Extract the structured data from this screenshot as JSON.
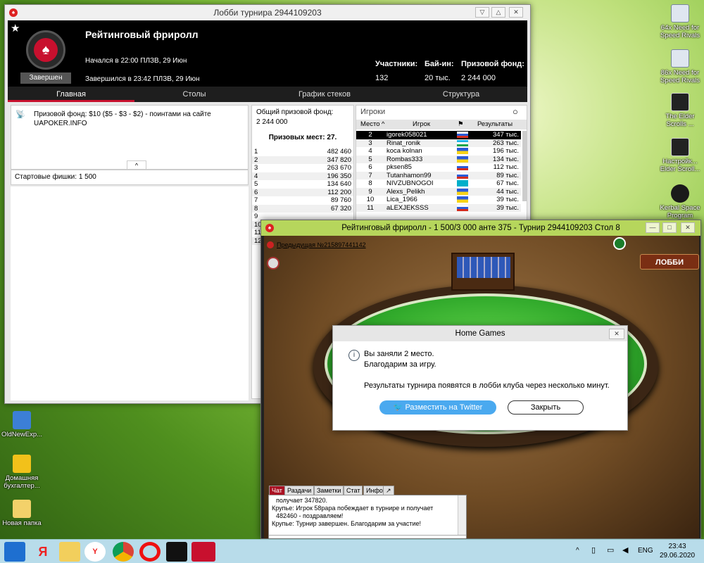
{
  "desktop_icons": [
    {
      "label": "64x Need for Speed Rivals"
    },
    {
      "label": "86x Need for Speed Rivals"
    },
    {
      "label": "The Elder Scrolls ..."
    },
    {
      "label": "Настройк... Elder Scroll..."
    },
    {
      "label": "Kerbal Space Program"
    },
    {
      "label": "OldNewExp..."
    },
    {
      "label": "Домашняя бухгалтер..."
    },
    {
      "label": "Новая папка"
    }
  ],
  "lobby": {
    "title": "Лобби турнира 2944109203",
    "tournament_name": "Рейтинговый фриролл",
    "status": "Завершен",
    "started": "Начался в 22:00 ПЛЗВ, 29 Июн",
    "ended": "Завершился в 23:42 ПЛЗВ, 29 Июн",
    "stats_labels": [
      "Участники:",
      "Бай-ин:",
      "Призовой фонд:"
    ],
    "stats_values": [
      "132",
      "20 тыс.",
      "2 244 000"
    ],
    "tabs": [
      "Главная",
      "Столы",
      "График стеков",
      "Структура"
    ],
    "info_text": "Призовой фонд: $10 ($5 - $3 - $2) - поинтами на сайте UAPOKER.INFO",
    "starting_chips": "Стартовые фишки:  1 500",
    "total_prize_label": "Общий призовой фонд:",
    "total_prize_value": "2 244 000",
    "paid_places": "Призовых мест: 27.",
    "payouts": [
      {
        "place": "1",
        "amount": "482 460"
      },
      {
        "place": "2",
        "amount": "347 820"
      },
      {
        "place": "3",
        "amount": "263 670"
      },
      {
        "place": "4",
        "amount": "196 350"
      },
      {
        "place": "5",
        "amount": "134 640"
      },
      {
        "place": "6",
        "amount": "112 200"
      },
      {
        "place": "7",
        "amount": "89 760"
      },
      {
        "place": "8",
        "amount": "67 320"
      },
      {
        "place": "9",
        "amount": ""
      },
      {
        "place": "10",
        "amount": ""
      },
      {
        "place": "11",
        "amount": ""
      },
      {
        "place": "12",
        "amount": ""
      }
    ],
    "players_search": "Игроки",
    "players_headers": [
      "Место",
      "Игрок",
      "Результаты"
    ],
    "players": [
      {
        "place": "2",
        "name": "igorek058021",
        "result": "347 тыс.",
        "flag": "ru"
      },
      {
        "place": "3",
        "name": "Rinat_ronik",
        "result": "263 тыс.",
        "flag": "uz"
      },
      {
        "place": "4",
        "name": "koca kolnan",
        "result": "196 тыс.",
        "flag": "ua"
      },
      {
        "place": "5",
        "name": "Rombas333",
        "result": "134 тыс.",
        "flag": "ua"
      },
      {
        "place": "6",
        "name": "pksen85",
        "result": "112 тыс.",
        "flag": "ru"
      },
      {
        "place": "7",
        "name": "Tutanhamon99",
        "result": "89 тыс.",
        "flag": "ru"
      },
      {
        "place": "8",
        "name": "NIVZUBNOGOI",
        "result": "67 тыс.",
        "flag": "kz"
      },
      {
        "place": "9",
        "name": "Alexs_Pelikh",
        "result": "44 тыс.",
        "flag": "ua"
      },
      {
        "place": "10",
        "name": "Lica_1966",
        "result": "39 тыс.",
        "flag": "ua"
      },
      {
        "place": "11",
        "name": "aLEXJEKSSS",
        "result": "39 тыс.",
        "flag": "ru"
      }
    ]
  },
  "table": {
    "title": "Рейтинговый фриролл - 1 500/3 000 анте 375 - Турнир 2944109203 Стол 8",
    "prev_hand": "Предыдущая №215897441142",
    "lobby_button": "ЛОББИ",
    "chat_tabs": [
      "Чат",
      "Раздачи",
      "Заметки",
      "Стат",
      "Инфо"
    ],
    "chat_lines": [
      "получает 347820.",
      "Крупье: Игрок 58papa побеждает в турнире и получает",
      "482460 - поздравляем!",
      "Крупье: Турнир завершен. Благодарим за участие!"
    ]
  },
  "dialog": {
    "title": "Home Games",
    "line1": "Вы заняли 2 место.",
    "line2": "Благодарим за игру.",
    "line3": "Результаты турнира появятся в лобби клуба через несколько минут.",
    "twitter_button": "Разместить на Twitter",
    "close_button": "Закрыть"
  },
  "taskbar": {
    "time": "23:43",
    "date": "29.06.2020",
    "lang": "ENG"
  }
}
